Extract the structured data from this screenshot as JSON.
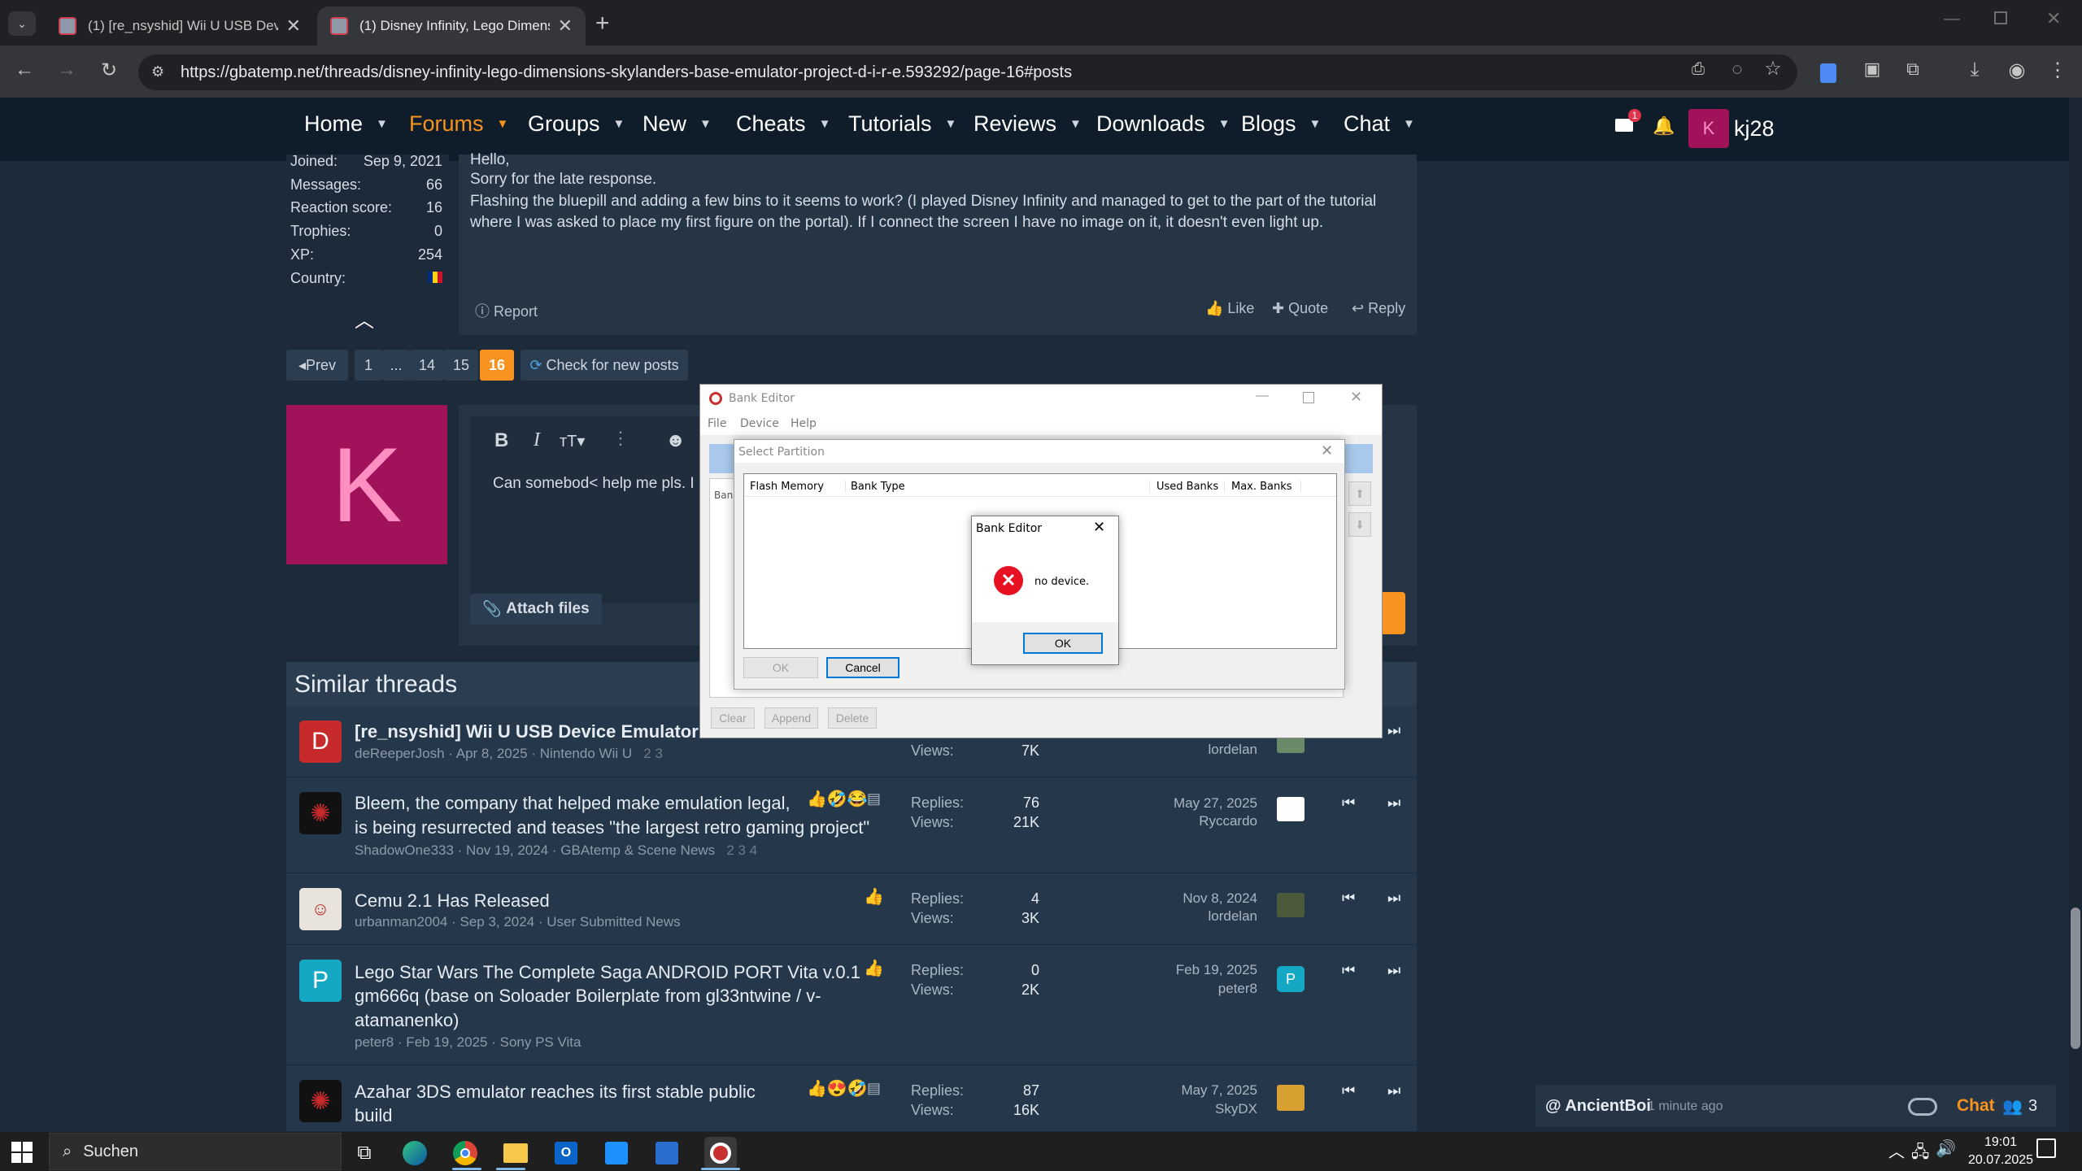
{
  "browser": {
    "tabs": [
      {
        "title": "(1) [re_nsyshid] Wii U USB Device E"
      },
      {
        "title": "(1) Disney Infinity, Lego Dimension"
      }
    ],
    "url": "https://gbatemp.net/threads/disney-infinity-lego-dimensions-skylanders-base-emulator-project-d-i-r-e.593292/page-16#posts"
  },
  "nav": {
    "items": [
      {
        "label": "Home"
      },
      {
        "label": "Forums"
      },
      {
        "label": "Groups"
      },
      {
        "label": "New"
      },
      {
        "label": "Cheats"
      },
      {
        "label": "Tutorials"
      },
      {
        "label": "Reviews"
      },
      {
        "label": "Downloads"
      },
      {
        "label": "Blogs"
      },
      {
        "label": "Chat"
      }
    ],
    "mail_count": "1",
    "user_initial": "K",
    "username": "kj28"
  },
  "post": {
    "stats": [
      {
        "label": "Joined:",
        "value": "Sep 9, 2021"
      },
      {
        "label": "Messages:",
        "value": "66"
      },
      {
        "label": "Reaction score:",
        "value": "16"
      },
      {
        "label": "Trophies:",
        "value": "0"
      },
      {
        "label": "XP:",
        "value": "254"
      },
      {
        "label": "Country:",
        "value": ""
      }
    ],
    "greeting": "Hello,",
    "line1": "Sorry for the late response.",
    "line2": "Flashing the bluepill and adding a few bins to it seems to work? (I played Disney Infinity and managed to get to the part of the tutorial",
    "line3": "where I was asked to place my first figure on the portal). If I connect the screen I have no image on it, it doesn't even light up.",
    "report": "Report",
    "like": "Like",
    "quote": "Quote",
    "reply": "Reply"
  },
  "pagination": {
    "prev": "Prev",
    "pages": [
      "1",
      "...",
      "14",
      "15",
      "16"
    ],
    "check": "Check for new posts"
  },
  "reply_box": {
    "avatar_initial": "K",
    "draft": "Can somebod< help me pls. I",
    "attach": "Attach files",
    "submit_partial": "y"
  },
  "similar": {
    "heading": "Similar threads",
    "threads": [
      {
        "avatar": "D",
        "title1": "[re_nsyshid] Wii U USB Device Emulator",
        "title2": "",
        "title3": "",
        "meta": "deReeperJosh · Apr 8, 2025 · Nintendo Wii U",
        "pages": "2   3",
        "replies": "",
        "views": "7K",
        "last_date": "",
        "last_user": "lordelan"
      },
      {
        "avatar": "",
        "title1": "Bleem, the company that helped make emulation legal,",
        "title2": "is being resurrected and teases \"the largest retro gaming project\"",
        "title3": "",
        "meta": "ShadowOne333 · Nov 19, 2024 · GBAtemp & Scene News",
        "pages": "2   3   4",
        "replies": "76",
        "views": "21K",
        "last_date": "May 27, 2025",
        "last_user": "Ryccardo"
      },
      {
        "avatar": "",
        "title1": "Cemu 2.1 Has Released",
        "title2": "",
        "title3": "",
        "meta": "urbanman2004 · Sep 3, 2024 · User Submitted News",
        "pages": "",
        "replies": "4",
        "views": "3K",
        "last_date": "Nov 8, 2024",
        "last_user": "lordelan"
      },
      {
        "avatar": "P",
        "title1": "Lego Star Wars The Complete Saga ANDROID PORT Vita v.0.1 -",
        "title2": "gm666q (base on Soloader Boilerplate from gl33ntwine / v-",
        "title3": "atamanenko)",
        "meta": "peter8 · Feb 19, 2025 · Sony PS Vita",
        "pages": "",
        "replies": "0",
        "views": "2K",
        "last_date": "Feb 19, 2025",
        "last_user": "peter8"
      },
      {
        "avatar": "",
        "title1": "Azahar 3DS emulator reaches its first stable public",
        "title2": "build",
        "title3": "",
        "meta": "",
        "pages": "",
        "replies": "87",
        "views": "16K",
        "last_date": "May 7, 2025",
        "last_user": "SkyDX"
      }
    ],
    "replies_label": "Replies:",
    "views_label": "Views:"
  },
  "chat_bar": {
    "user": "@ AncientBoi",
    "time": "1 minute ago",
    "label": "Chat",
    "count": "3"
  },
  "bank_editor": {
    "title": "Bank Editor",
    "menu": [
      "File",
      "Device",
      "Help"
    ],
    "bottom_buttons": [
      "Clear",
      "Append",
      "Delete"
    ],
    "left_partial": "Ban"
  },
  "select_partition": {
    "title": "Select Partition",
    "columns": [
      "Flash Memory",
      "Bank Type",
      "Used Banks",
      "Max. Banks"
    ],
    "ok": "OK",
    "cancel": "Cancel"
  },
  "error_box": {
    "title": "Bank Editor",
    "message": "no device.",
    "ok": "OK"
  },
  "taskbar": {
    "search": "Suchen",
    "time": "19:01",
    "date": "20.07.2025"
  }
}
